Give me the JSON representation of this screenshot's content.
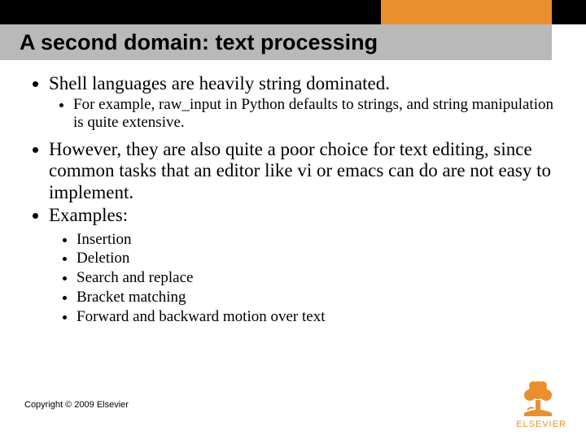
{
  "header": {
    "title": "A second domain: text processing"
  },
  "bullets": {
    "b1": "Shell languages are heavily string dominated.",
    "b1_sub": "For example, raw_input in Python defaults to strings, and string manipulation is quite extensive.",
    "b2": "However, they are also quite a poor choice for text editing, since common tasks that an editor like vi or emacs can do are not easy to implement.",
    "b3": "Examples:",
    "ex1": "Insertion",
    "ex2": "Deletion",
    "ex3": "Search and replace",
    "ex4": "Bracket matching",
    "ex5": "Forward and backward motion over text"
  },
  "footer": {
    "copyright": "Copyright © 2009 Elsevier",
    "logo_text": "ELSEVIER"
  }
}
